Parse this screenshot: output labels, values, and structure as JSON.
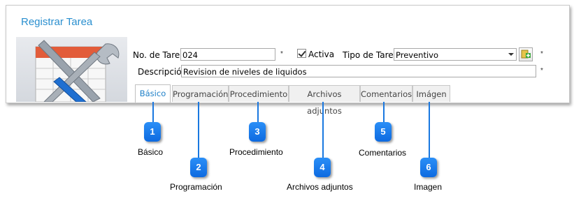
{
  "window": {
    "title": "Registrar Tarea"
  },
  "form": {
    "no_tarea_label": "No. de Tarea:",
    "no_tarea_value": "024",
    "required_mark": "*",
    "activa_label": "Activa",
    "activa_checked": true,
    "tipo_tarea_label": "Tipo de Tarea:",
    "tipo_tarea_value": "Preventivo",
    "descripcion_label": "Descripción:",
    "descripcion_value": "Revision de niveles de liquidos"
  },
  "tabs": [
    {
      "label": "Básico",
      "active": true
    },
    {
      "label": "Programación",
      "active": false
    },
    {
      "label": "Procedimiento",
      "active": false
    },
    {
      "label": "Archivos adjuntos",
      "active": false
    },
    {
      "label": "Comentarios",
      "active": false
    },
    {
      "label": "Imágen",
      "active": false
    }
  ],
  "callouts": [
    {
      "number": "1",
      "caption": "Básico"
    },
    {
      "number": "2",
      "caption": "Programación"
    },
    {
      "number": "3",
      "caption": "Procedimiento"
    },
    {
      "number": "4",
      "caption": "Archivos adjuntos"
    },
    {
      "number": "5",
      "caption": "Comentarios"
    },
    {
      "number": "6",
      "caption": "Imagen"
    }
  ],
  "colors": {
    "accent": "#1f80c8",
    "callout": "#1a78e0"
  }
}
